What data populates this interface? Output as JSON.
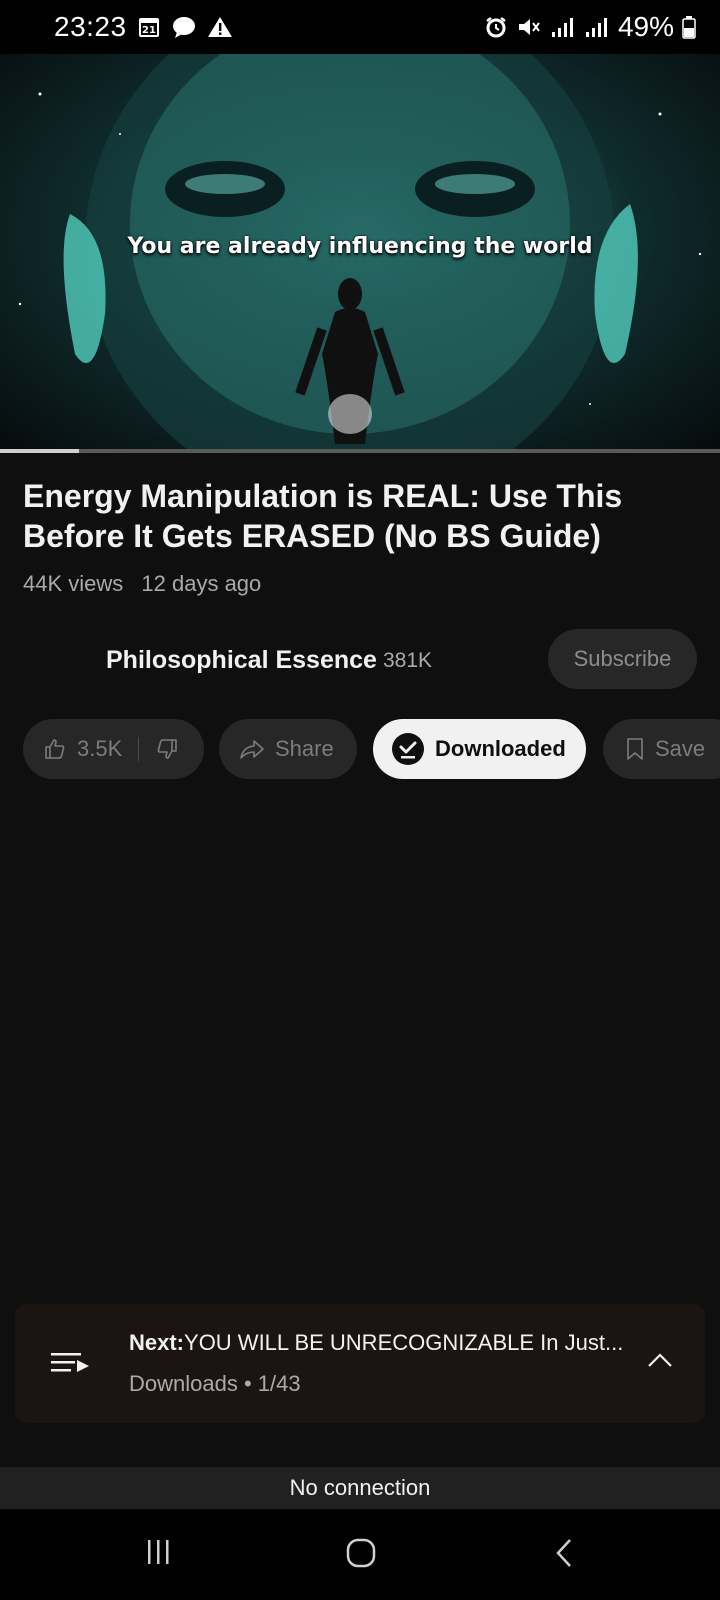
{
  "status_bar": {
    "time": "23:23",
    "calendar_day": "21",
    "battery": "49%"
  },
  "video": {
    "caption": "You are already influencing the world",
    "progress_fraction": 0.11
  },
  "video_info": {
    "title": "Energy Manipulation is REAL: Use This Before It Gets ERASED (No BS Guide)",
    "views": "44K views",
    "age": "12 days ago"
  },
  "channel": {
    "name": "Philosophical Essence",
    "subscribers": "381K",
    "subscribe_label": "Subscribe"
  },
  "actions": {
    "likes": "3.5K",
    "share_label": "Share",
    "download_label": "Downloaded",
    "save_label": "Save"
  },
  "next": {
    "prefix": "Next:",
    "title": "YOU WILL BE UNRECOGNIZABLE In Just...",
    "playlist": "Downloads",
    "separator": "•",
    "position": "1/43"
  },
  "banner": {
    "text": "No connection"
  },
  "colors": {
    "background": "#0f0f0f",
    "pill": "#272727",
    "accent_teal": "#3d9d94",
    "next_bar": "#1c1412"
  }
}
